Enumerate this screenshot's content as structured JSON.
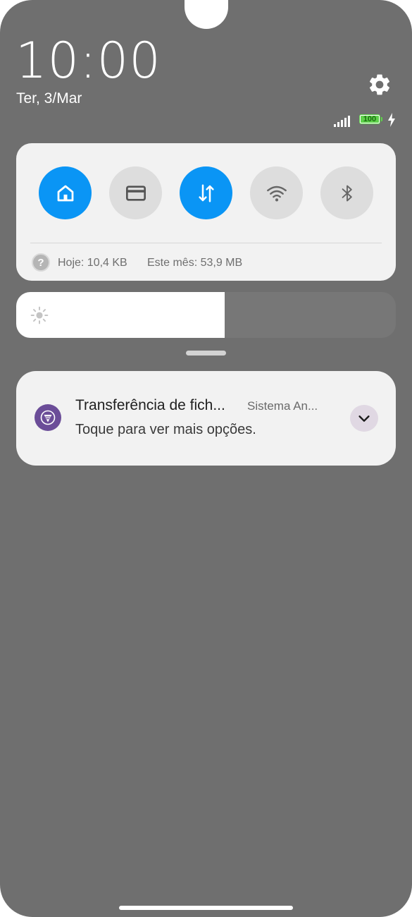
{
  "status": {
    "time": "10:00",
    "date": "Ter, 3/Mar",
    "battery_level": "100",
    "battery_fraction": 1.0
  },
  "quick_settings": {
    "tiles": [
      {
        "name": "home-tile",
        "icon": "home-icon",
        "active": true
      },
      {
        "name": "card-tile",
        "icon": "card-icon",
        "active": false
      },
      {
        "name": "mobile-data-tile",
        "icon": "data-transfer-icon",
        "active": true
      },
      {
        "name": "wifi-tile",
        "icon": "wifi-icon",
        "active": false
      },
      {
        "name": "bluetooth-tile",
        "icon": "bluetooth-icon",
        "active": false
      }
    ],
    "usage_today": "Hoje: 10,4 KB",
    "usage_month": "Este mês: 53,9 MB"
  },
  "brightness": {
    "level": 0.55,
    "icon": "sun-icon"
  },
  "notification": {
    "title": "Transferência de fich...",
    "source": "Sistema An...",
    "text": "Toque para ver mais opções.",
    "app_icon": "usb-transfer-icon"
  },
  "colors": {
    "accent": "#0a95f5",
    "tile_off": "#dddddd",
    "panel": "#f2f2f2",
    "background": "#6f6f6f",
    "battery": "#5ed24a",
    "app_icon": "#6b4d98"
  }
}
